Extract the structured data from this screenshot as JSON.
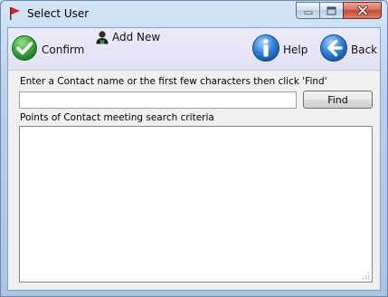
{
  "window": {
    "title": "Select User",
    "caption_buttons": {
      "minimize_icon": "minimize-icon",
      "maximize_icon": "maximize-icon",
      "close_icon": "close-icon"
    }
  },
  "toolbar": {
    "confirm_label": "Confirm",
    "confirm_icon": "checkmark-icon",
    "add_new_label": "Add New",
    "add_new_icon": "user-icon",
    "help_label": "Help",
    "help_icon": "info-icon",
    "back_label": "Back",
    "back_icon": "back-arrow-icon"
  },
  "search": {
    "instruction": "Enter a Contact name or the first few characters then click 'Find'",
    "value": "",
    "placeholder": "",
    "find_label": "Find"
  },
  "results": {
    "label": "Points of Contact meeting search criteria",
    "items": []
  },
  "colors": {
    "toolbar_bg": "#e6e6f7",
    "confirm_green": "#3aa53a",
    "help_blue": "#2f7fd6",
    "close_red": "#c9503c",
    "app_icon_red": "#d42020"
  }
}
